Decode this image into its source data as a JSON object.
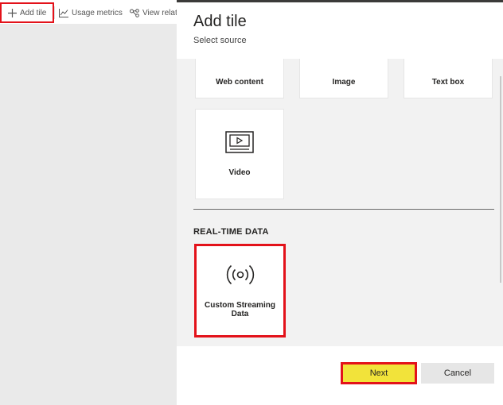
{
  "toolbar": {
    "add_tile": "Add tile",
    "add_icon": "plus-icon",
    "usage_metrics": "Usage metrics",
    "usage_icon": "line-chart-icon",
    "view_related": "View relate",
    "view_icon": "share-nodes-icon"
  },
  "panel": {
    "title": "Add tile",
    "subtitle": "Select source",
    "tiles": {
      "web_content": "Web content",
      "image": "Image",
      "text_box": "Text box",
      "video": "Video",
      "video_icon": "video-player-icon"
    },
    "realtime_section": "REAL-TIME DATA",
    "streaming_tile": "Custom Streaming Data",
    "streaming_icon": "broadcast-signal-icon"
  },
  "footer": {
    "next_label": "Next",
    "cancel_label": "Cancel"
  },
  "colors": {
    "highlight": "#e3121a",
    "next_button": "#f2e33a",
    "panel_bg": "#f2f2f2"
  }
}
